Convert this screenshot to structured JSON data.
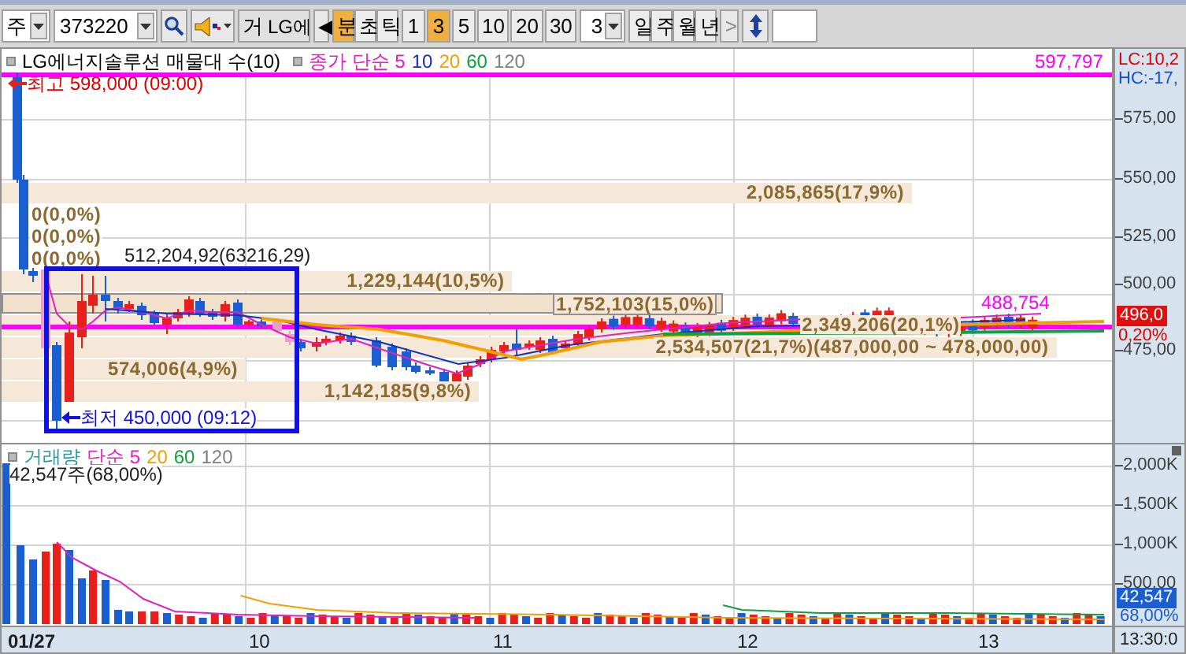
{
  "toolbar": {
    "market": "주",
    "code": "373220",
    "name_prefix": "거",
    "name": "LG에",
    "prev": "◀",
    "units": [
      {
        "label": "분",
        "selected": true
      },
      {
        "label": "초",
        "selected": false
      },
      {
        "label": "틱",
        "selected": false
      }
    ],
    "intervals": [
      {
        "label": "1",
        "selected": false
      },
      {
        "label": "3",
        "selected": true
      },
      {
        "label": "5",
        "selected": false
      },
      {
        "label": "10",
        "selected": false
      },
      {
        "label": "20",
        "selected": false
      },
      {
        "label": "30",
        "selected": false
      }
    ],
    "count": "3",
    "periods": [
      "일",
      "주",
      "월",
      "년"
    ],
    "next": ">"
  },
  "price_chart": {
    "title": "LG에너지솔루션 매물대 수(10)",
    "ma_legend": [
      {
        "label": "종가 단순 5",
        "color": "#e020c0"
      },
      {
        "label": "10",
        "color": "#1030c0"
      },
      {
        "label": "20",
        "color": "#f0a000"
      },
      {
        "label": "60",
        "color": "#10a040"
      },
      {
        "label": "120",
        "color": "#808080"
      }
    ],
    "high_label": "최고 598,000 (09:00)",
    "low_label": "최저 450,000 (09:12)",
    "box_label": "512,204,92(63216,29)",
    "top_line_label": "597,797",
    "mid_line_label": "488,754",
    "volume_profile": [
      {
        "label": "2,085,865(17,9%)",
        "level": 0.82,
        "highlighted": false
      },
      {
        "label": "0(0,0%)",
        "level": 0,
        "highlighted": false
      },
      {
        "label": "0(0,0%)",
        "level": 0,
        "highlighted": false
      },
      {
        "label": "0(0,0%)",
        "level": 0,
        "highlighted": false
      },
      {
        "label": "1,229,144(10,5%)",
        "level": 0.46,
        "highlighted": false
      },
      {
        "label": "1,752,103(15,0%)",
        "level": 0.65,
        "highlighted": true
      },
      {
        "label": "2,349,206(20,1%)",
        "level": 0.87,
        "highlighted": false
      },
      {
        "label": "2,534,507(21,7%)(487,000,00 ~ 478,000,00)",
        "level": 0.95,
        "highlighted": false
      },
      {
        "label": "574,006(4,9%)",
        "level": 0.22,
        "highlighted": false
      },
      {
        "label": "1,142,185(9,8%)",
        "level": 0.43,
        "highlighted": false
      }
    ],
    "axis": {
      "lc": "LC:10,2",
      "hc": "HC:-17,",
      "ticks": [
        "575,00",
        "550,00",
        "525,00",
        "500,00",
        "475,00"
      ],
      "price": "496,0",
      "change": "0,20%"
    }
  },
  "volume_chart": {
    "legend": [
      {
        "label": "거래량",
        "color": "#2a9a9a"
      },
      {
        "label": "단순 5",
        "color": "#e020c0"
      },
      {
        "label": "20",
        "color": "#f0a000"
      },
      {
        "label": "60",
        "color": "#10a040"
      },
      {
        "label": "120",
        "color": "#808080"
      }
    ],
    "reading": "42,547주(68,00%)",
    "axis": {
      "ticks": [
        "2,000K",
        "1,500K",
        "1,000K",
        "500,00"
      ],
      "volume": "42,547",
      "ratio": "68,00%"
    }
  },
  "time_axis": {
    "labels": [
      "01/27",
      "10",
      "11",
      "12",
      "13"
    ],
    "time": "13:30:0"
  }
}
